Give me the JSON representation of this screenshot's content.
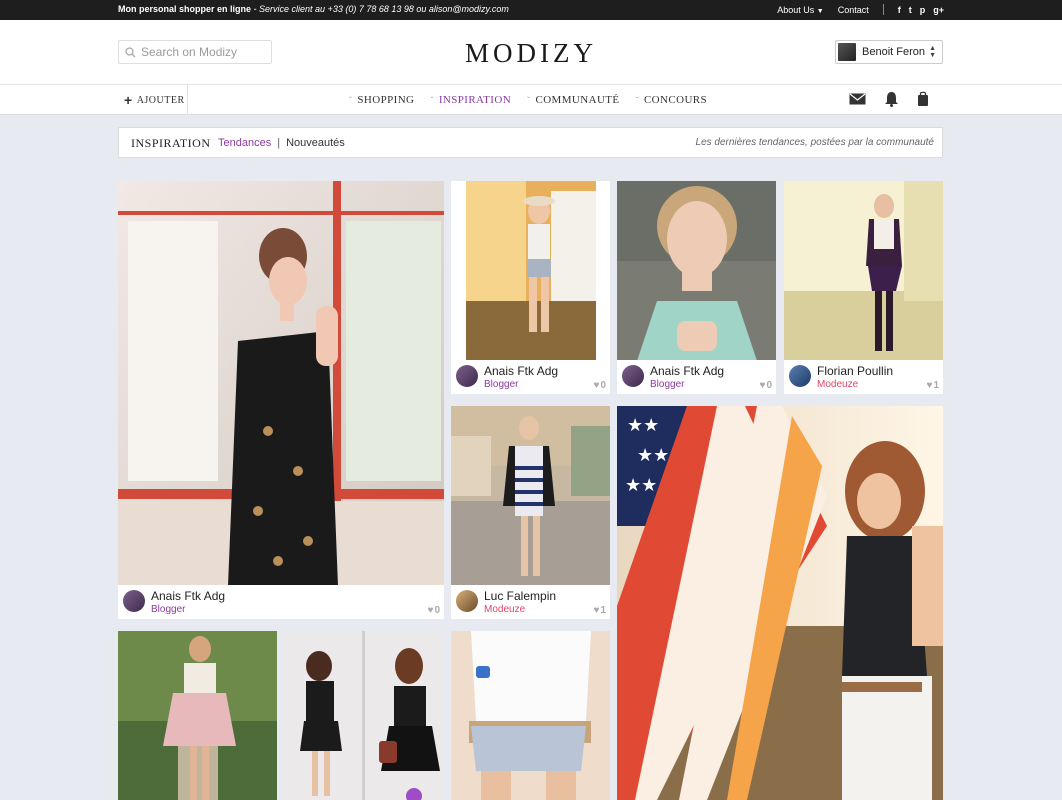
{
  "topbar": {
    "tagline": "Mon personal shopper en ligne",
    "service": "- Service client au +33 (0) 7 78 68 13 98 ou alison@modizy.com",
    "about": "About Us",
    "contact": "Contact",
    "social": [
      "f",
      "t",
      "p",
      "g+"
    ]
  },
  "header": {
    "search_placeholder": "Search on Modizy",
    "logo": "MODIZY",
    "user_name": "Benoit Feron"
  },
  "nav": {
    "add_label": "AJOUTER",
    "items": [
      "SHOPPING",
      "INSPIRATION",
      "COMMUNAUTÉ",
      "CONCOURS"
    ],
    "active": "INSPIRATION",
    "icons": [
      "mail-icon",
      "bell-icon",
      "bag-icon"
    ]
  },
  "subbar": {
    "title": "INSPIRATION",
    "tab_active": "Tendances",
    "tab_other": "Nouveautés",
    "separator": "|",
    "tagline": "Les dernières tendances, postées par la communauté"
  },
  "posts": [
    {
      "user": "Anais Ftk Adg",
      "role": "Blogger",
      "likes": "0"
    },
    {
      "user": "Anais Ftk Adg",
      "role": "Blogger",
      "likes": "0"
    },
    {
      "user": "Anais Ftk Adg",
      "role": "Blogger",
      "likes": "0"
    },
    {
      "user": "Florian Poullin",
      "role": "Modeuze",
      "likes": "1"
    },
    {
      "user": "Luc Falempin",
      "role": "Modeuze",
      "likes": "1"
    }
  ],
  "colors": {
    "accent_purple": "#8b3aa0",
    "accent_pink": "#e0456a",
    "page_bg": "#e8eaf2",
    "topbar_bg": "#1e1e1e"
  }
}
